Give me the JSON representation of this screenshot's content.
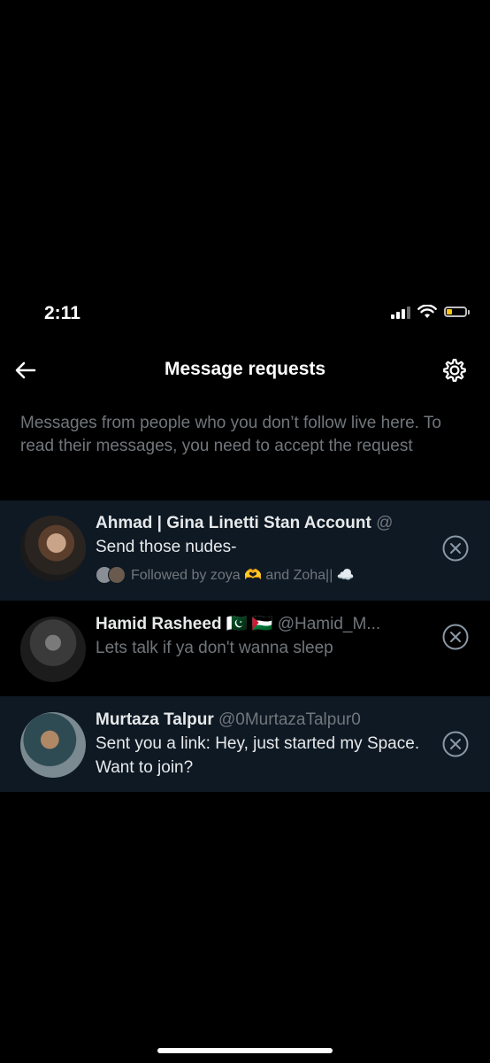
{
  "status_bar": {
    "time": "2:11"
  },
  "header": {
    "title": "Message requests"
  },
  "info_text": "Messages from people who you don’t follow live here. To read their messages, you need to accept the request",
  "requests": [
    {
      "name": "Ahmad | Gina Linetti Stan Account",
      "handle": "@",
      "preview": "Send those nudes-",
      "followed_by": "Followed by zoya 🫶 and Zoha|| ☁️"
    },
    {
      "name": "Hamid Rasheed 🇵🇰 🇵🇸",
      "handle": "@Hamid_M...",
      "preview": "Lets talk if ya don't wanna sleep"
    },
    {
      "name": "Murtaza Talpur",
      "handle": "@0MurtazaTalpur0",
      "preview": "Sent you a link: Hey, just started my Space. Want to join?"
    }
  ],
  "colors": {
    "background": "#000000",
    "highlight_row": "#0e1924",
    "secondary_text": "#71767b",
    "primary_text": "#e7e9ea"
  },
  "icons": [
    "back-arrow-icon",
    "gear-icon",
    "dismiss-x-icon",
    "signal-icon",
    "wifi-icon",
    "battery-icon"
  ]
}
